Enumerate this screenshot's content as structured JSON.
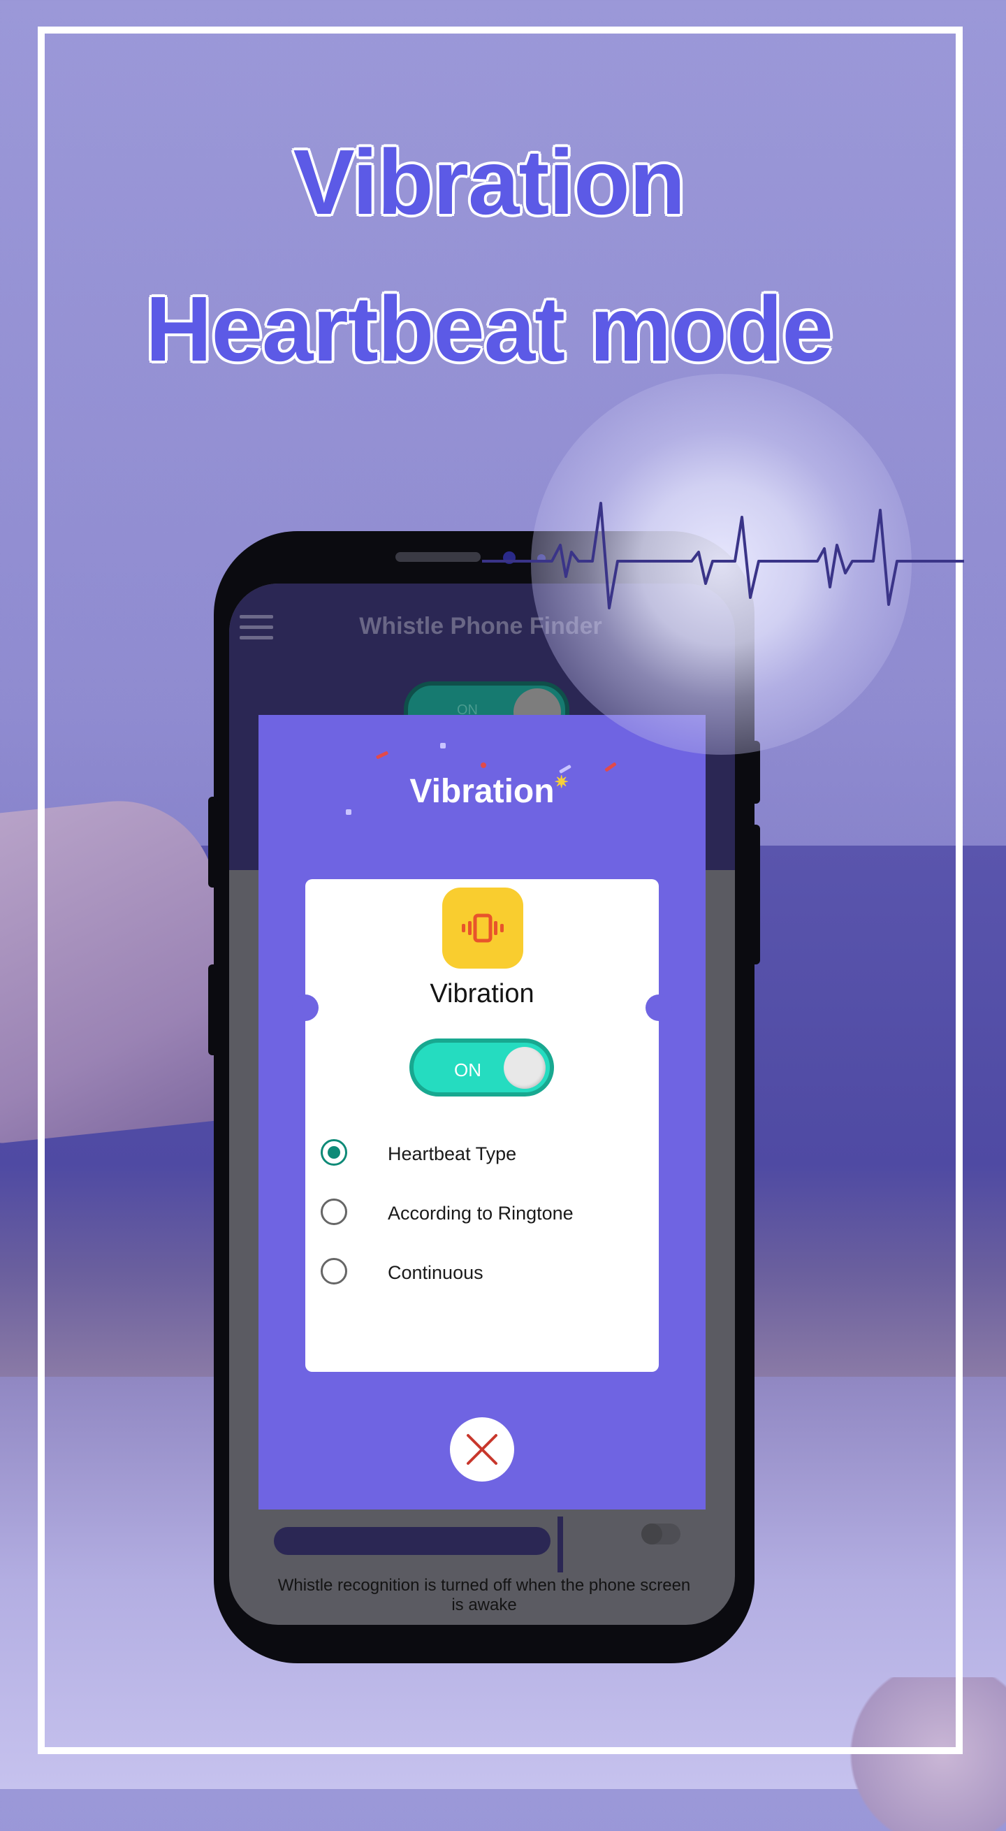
{
  "headline": {
    "line1": "Vibration",
    "line2": "Heartbeat mode"
  },
  "app": {
    "title": "Whistle Phone Finder",
    "bg_toggle_label": "ON",
    "footnote": "Whistle recognition is turned off when the phone screen is awake"
  },
  "dialog": {
    "title": "Vibration",
    "card_title": "Vibration",
    "toggle_label": "ON",
    "options": [
      {
        "label": "Heartbeat Type",
        "selected": true
      },
      {
        "label": "According to Ringtone",
        "selected": false
      },
      {
        "label": "Continuous",
        "selected": false
      }
    ]
  },
  "icons": {
    "vibration": "phone-vibrate-icon",
    "close": "close-icon",
    "menu": "hamburger-menu-icon",
    "sparkle": "sparkle-icon"
  },
  "colors": {
    "dialog_bg": "#6f64e2",
    "accent_toggle": "#25dcc0",
    "icon_bg": "#f9cd2f",
    "headline": "#5c5ae6",
    "radio_selected": "#0e8a77"
  }
}
